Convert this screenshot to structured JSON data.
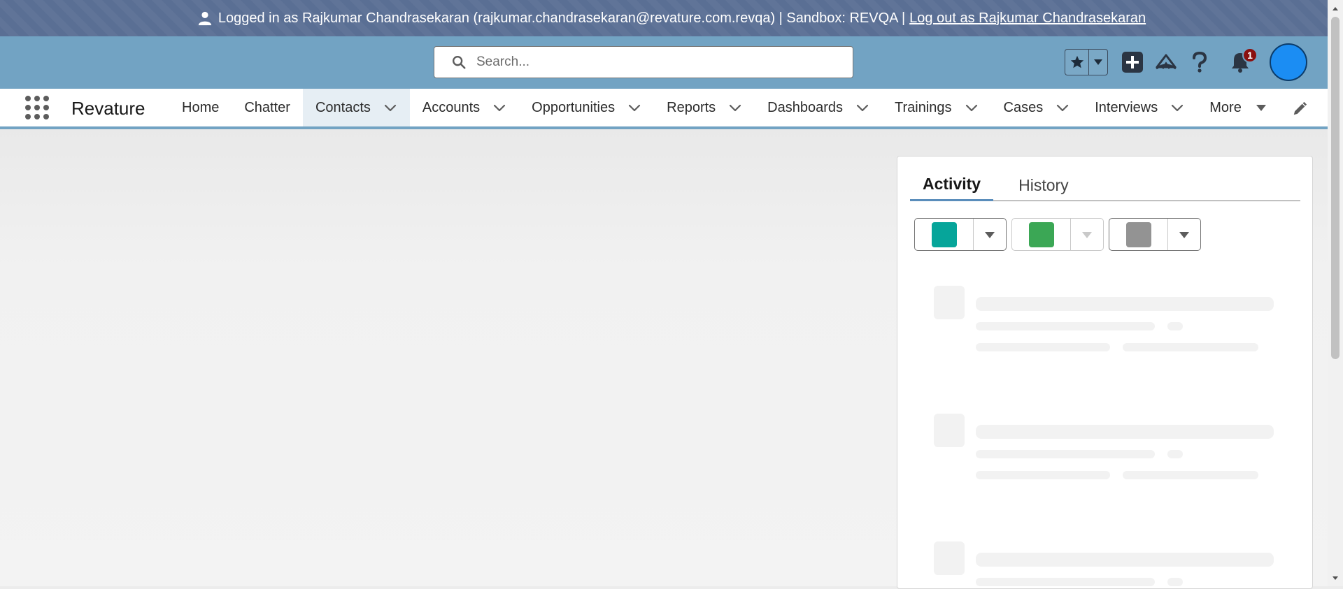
{
  "banner": {
    "logged_in_text": "Logged in as Rajkumar Chandrasekaran (rajkumar.chandrasekaran@revature.com.revqa) | Sandbox: REVQA |",
    "logout_label": "Log out as Rajkumar Chandrasekaran"
  },
  "header": {
    "search_placeholder": "Search...",
    "notification_count": "1",
    "icons": [
      "favorites-star-icon",
      "global-actions-plus-icon",
      "trailhead-icon",
      "help-icon",
      "notification-bell-icon",
      "avatar"
    ]
  },
  "nav": {
    "app_name": "Revature",
    "items": [
      {
        "label": "Home",
        "has_menu": false,
        "active": false
      },
      {
        "label": "Chatter",
        "has_menu": false,
        "active": false
      },
      {
        "label": "Contacts",
        "has_menu": true,
        "active": true
      },
      {
        "label": "Accounts",
        "has_menu": true,
        "active": false
      },
      {
        "label": "Opportunities",
        "has_menu": true,
        "active": false
      },
      {
        "label": "Reports",
        "has_menu": true,
        "active": false
      },
      {
        "label": "Dashboards",
        "has_menu": true,
        "active": false
      },
      {
        "label": "Trainings",
        "has_menu": true,
        "active": false
      },
      {
        "label": "Cases",
        "has_menu": true,
        "active": false
      },
      {
        "label": "Interviews",
        "has_menu": true,
        "active": false
      }
    ],
    "more_label": "More"
  },
  "activity_panel": {
    "tabs": [
      {
        "label": "Activity",
        "active": true
      },
      {
        "label": "History",
        "active": false
      }
    ],
    "quick_actions": [
      {
        "color": "#06a59a",
        "disabled": false
      },
      {
        "color": "#3ba755",
        "disabled": true
      },
      {
        "color": "#939393",
        "disabled": false
      }
    ]
  },
  "colors": {
    "banner_bg": "#5a6f94",
    "header_bg": "#72a3c3",
    "avatar": "#1b8df3",
    "badge": "#8a0f0f",
    "tab_underline": "#5a8dbb"
  }
}
